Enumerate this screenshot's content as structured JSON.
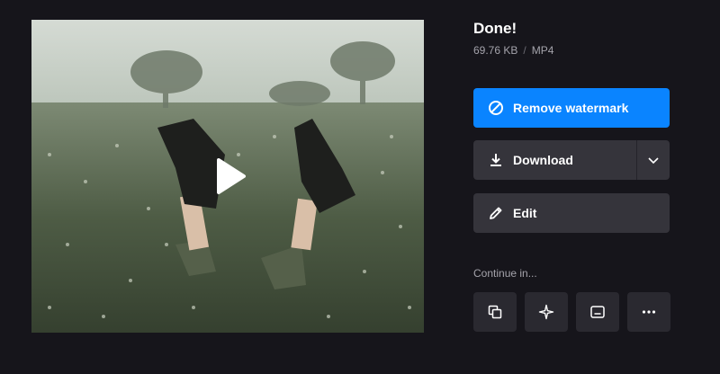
{
  "status": {
    "title": "Done!",
    "file_size": "69.76 KB",
    "separator": "/",
    "format": "MP4"
  },
  "actions": {
    "remove_watermark": {
      "label": "Remove watermark",
      "icon": "block-icon"
    },
    "download": {
      "label": "Download",
      "icon": "download-icon",
      "caret_icon": "chevron-down-icon"
    },
    "edit": {
      "label": "Edit",
      "icon": "pencil-icon"
    }
  },
  "continue": {
    "label": "Continue in...",
    "tools": [
      {
        "icon": "layers-icon"
      },
      {
        "icon": "sparkle-icon"
      },
      {
        "icon": "subtitles-icon"
      },
      {
        "icon": "more-icon"
      }
    ]
  },
  "preview": {
    "play_icon": "play-icon"
  },
  "colors": {
    "background": "#16151b",
    "primary": "#0a84ff",
    "button": "#35343b",
    "tool_button": "#2a2930",
    "muted_text": "#a4a3ab"
  }
}
